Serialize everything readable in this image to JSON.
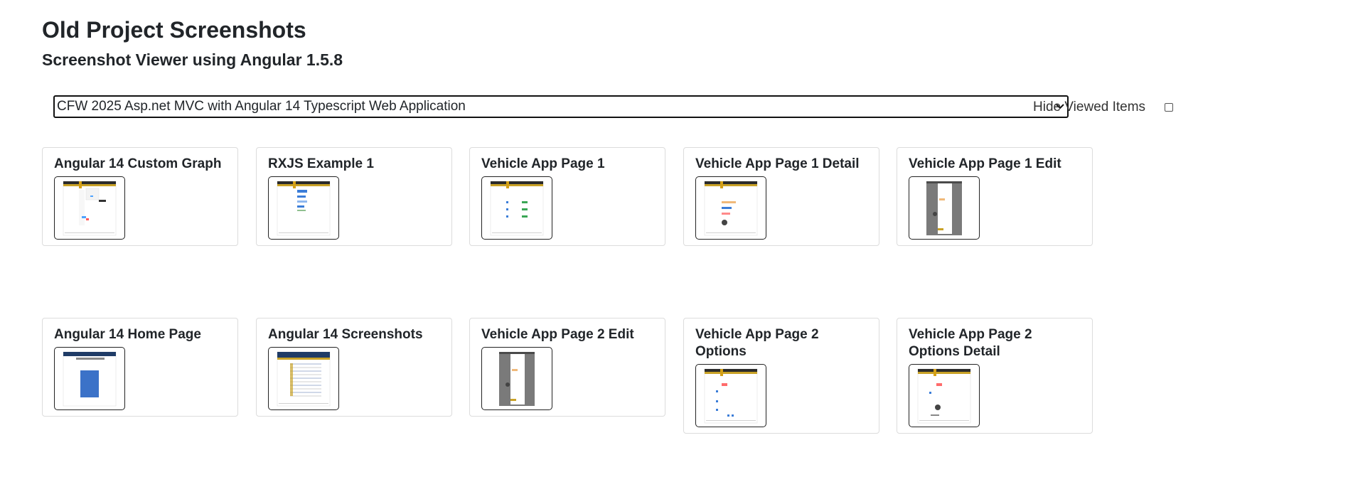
{
  "header": {
    "title": "Old Project Screenshots",
    "subtitle": "Screenshot Viewer using Angular 1.5.8"
  },
  "controls": {
    "project_select_value": "CFW 2025 Asp.net MVC with Angular 14 Typescript Web Application",
    "hide_viewed_label": "Hide Viewed Items",
    "hide_viewed_checked": false
  },
  "icons": {
    "select_chevron": "chevron-down-icon"
  },
  "screenshots": [
    {
      "label": "Angular 14 Custom Graph",
      "thumb_style": "graph"
    },
    {
      "label": "RXJS Example 1",
      "thumb_style": "list"
    },
    {
      "label": "Vehicle App Page 1",
      "thumb_style": "list-green"
    },
    {
      "label": "Vehicle App Page 1 Detail",
      "thumb_style": "detail"
    },
    {
      "label": "Vehicle App Page 1 Edit",
      "thumb_style": "dark-modal"
    },
    {
      "label": "Angular 14 Home Page",
      "thumb_style": "blue-home"
    },
    {
      "label": "Angular 14 Screenshots",
      "thumb_style": "table"
    },
    {
      "label": "Vehicle App Page 2 Edit",
      "thumb_style": "dark-modal"
    },
    {
      "label": "Vehicle App Page 2 Options",
      "thumb_style": "options"
    },
    {
      "label": "Vehicle App Page 2 Options Detail",
      "thumb_style": "options-detail"
    }
  ]
}
